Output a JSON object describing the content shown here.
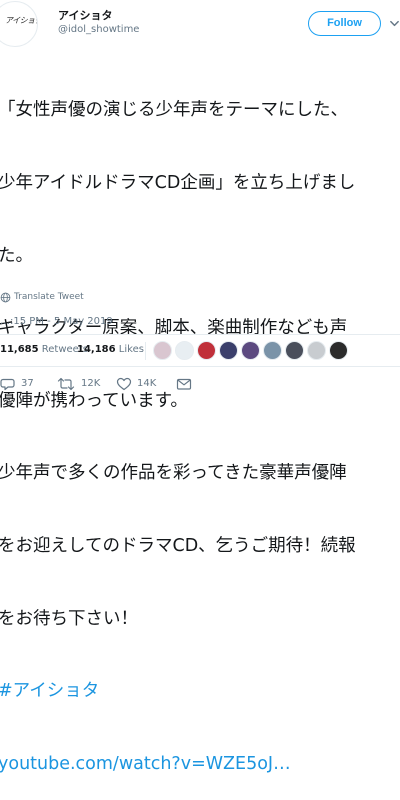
{
  "user": {
    "display_name": "アイショタ",
    "handle": "@idol_showtime",
    "avatar_text": "アイショタ"
  },
  "follow_button": {
    "label": "Follow"
  },
  "tweet": {
    "lines": [
      "「女性声優の演じる少年声をテーマにした、",
      "少年アイドルドラマCD企画」を立ち上げまし",
      "た。",
      "キャラクター原案、脚本、楽曲制作なども声",
      "優陣が携わっています。",
      "少年声で多くの作品を彩ってきた豪華声優陣",
      "をお迎えしてのドラマCD、乞うご期待！続報",
      "をお待ち下さい！"
    ],
    "hashtag": "#アイショタ",
    "link": "youtube.com/watch?v=WZE5oJ…"
  },
  "translate": {
    "label": "Translate Tweet",
    "icon": "globe-icon"
  },
  "timestamp": "…:15 PM - 5 May 2019",
  "stats": {
    "retweets_count": "11,685",
    "retweets_label": "Retweets",
    "likes_count": "14,186",
    "likes_label": "Likes",
    "liker_avatar_colors": [
      "#d9c6d0",
      "#e8eef2",
      "#c0303a",
      "#3b3f6b",
      "#5c4a80",
      "#7a93a8",
      "#4a4f5c",
      "#c8ccd0",
      "#2b2b2b"
    ]
  },
  "actions": {
    "replies": "37",
    "retweets": "12K",
    "likes": "14K"
  },
  "colors": {
    "accent": "#1da1f2",
    "link": "#1b95e0",
    "muted": "#657786",
    "border": "#e6ecf0"
  }
}
